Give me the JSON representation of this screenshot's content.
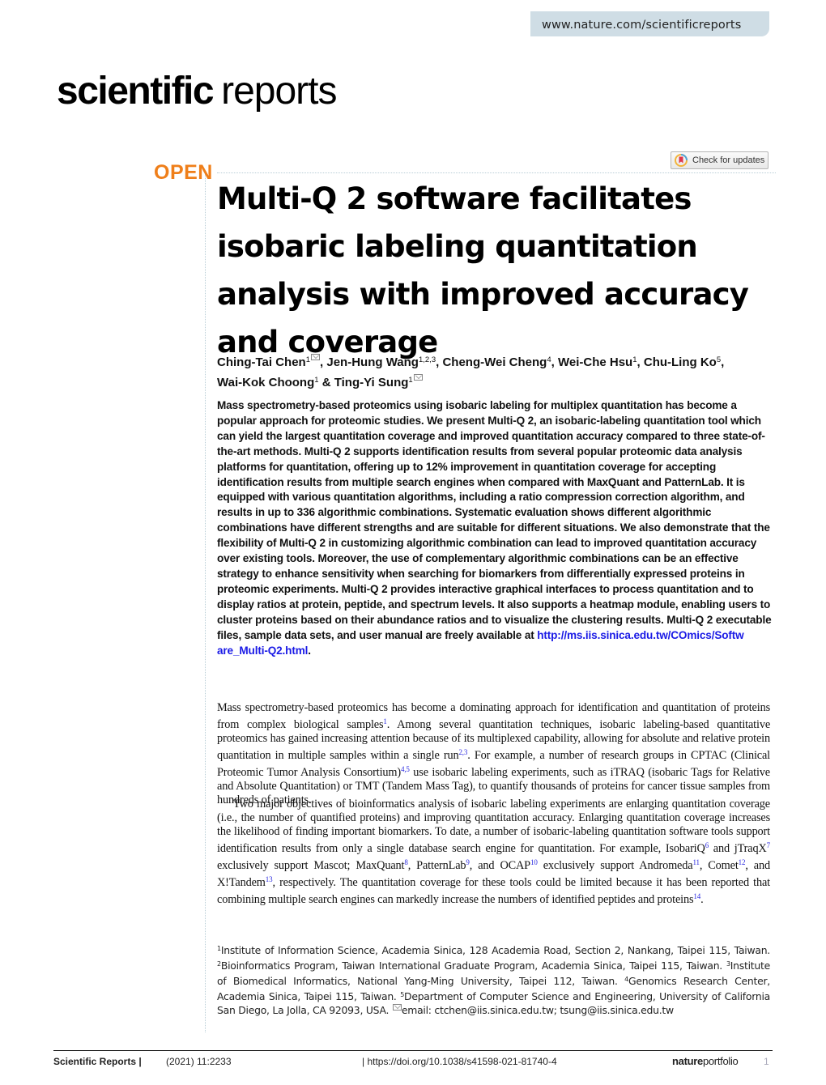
{
  "header": {
    "url": "www.nature.com/scientificreports",
    "journal_name_bold": "scientific",
    "journal_name_light": "reports",
    "check_updates_label": "Check for updates",
    "access_badge": "OPEN"
  },
  "article": {
    "title": "Multi-Q 2 software facilitates isobaric labeling quantitation analysis with improved accuracy and coverage",
    "authors": [
      {
        "name": "Ching-Tai Chen",
        "affil": "1",
        "corresponding": true,
        "sep": ", "
      },
      {
        "name": "Jen-Hung Wang",
        "affil": "1,2,3",
        "corresponding": false,
        "sep": ", "
      },
      {
        "name": "Cheng-Wei Cheng",
        "affil": "4",
        "corresponding": false,
        "sep": ", "
      },
      {
        "name": "Wei-Che Hsu",
        "affil": "1",
        "corresponding": false,
        "sep": ", "
      },
      {
        "name": "Chu-Ling Ko",
        "affil": "5",
        "corresponding": false,
        "sep": ", "
      },
      {
        "name": "Wai-Kok Choong",
        "affil": "1",
        "corresponding": false,
        "sep": " & "
      },
      {
        "name": "Ting-Yi Sung",
        "affil": "1",
        "corresponding": true,
        "sep": ""
      }
    ],
    "abstract": "Mass spectrometry-based proteomics using isobaric labeling for multiplex quantitation has become a popular approach for proteomic studies. We present Multi-Q 2, an isobaric-labeling quantitation tool which can yield the largest quantitation coverage and improved quantitation accuracy compared to three state-of-the-art methods. Multi-Q 2 supports identification results from several popular proteomic data analysis platforms for quantitation, offering up to 12% improvement in quantitation coverage for accepting identification results from multiple search engines when compared with MaxQuant and PatternLab. It is equipped with various quantitation algorithms, including a ratio compression correction algorithm, and results in up to 336 algorithmic combinations. Systematic evaluation shows different algorithmic combinations have different strengths and are suitable for different situations. We also demonstrate that the flexibility of Multi-Q 2 in customizing algorithmic combination can lead to improved quantitation accuracy over existing tools. Moreover, the use of complementary algorithmic combinations can be an effective strategy to enhance sensitivity when searching for biomarkers from differentially expressed proteins in proteomic experiments. Multi-Q 2 provides interactive graphical interfaces to process quantitation and to display ratios at protein, peptide, and spectrum levels. It also supports a heatmap module, enabling users to cluster proteins based on their abundance ratios and to visualize the clustering results. Multi-Q 2 executable files, sample data sets, and user manual are freely available at ",
    "abstract_link": "http://ms.iis.sinica.edu.tw/COmics/Software_Multi-Q2.html",
    "abstract_end": ".",
    "paragraphs": [
      [
        {
          "t": "Mass spectrometry-based proteomics has become a dominating approach for identification and quantitation of proteins from complex biological samples"
        },
        {
          "c": "1"
        },
        {
          "t": ". Among several quantitation techniques, isobaric labeling-based quantitative proteomics has gained increasing attention because of its multiplexed capability, allowing for absolute and relative protein quantitation in multiple samples within a single run"
        },
        {
          "c": "2,3"
        },
        {
          "t": ". For example, a number of research groups in CPTAC (Clinical Proteomic Tumor Analysis Consortium)"
        },
        {
          "c": "4,5"
        },
        {
          "t": " use isobaric labeling experiments, such as iTRAQ (isobaric Tags for Relative and Absolute Quantitation) or TMT (Tandem Mass Tag), to quantify thousands of proteins for cancer tissue samples from hundreds of patients."
        }
      ],
      [
        {
          "t": "Two major objectives of bioinformatics analysis of isobaric labeling experiments are enlarging quantitation coverage (i.e., the number of quantified proteins) and improving quantitation accuracy. Enlarging quantitation coverage increases the likelihood of finding important biomarkers. To date, a number of isobaric-labeling quantitation software tools support identification results from only a single database search engine for quantitation. For example, IsobariQ"
        },
        {
          "c": "6"
        },
        {
          "t": " and jTraqX"
        },
        {
          "c": "7"
        },
        {
          "t": " exclusively support Mascot; MaxQuant"
        },
        {
          "c": "8"
        },
        {
          "t": ", PatternLab"
        },
        {
          "c": "9"
        },
        {
          "t": ", and OCAP"
        },
        {
          "c": "10"
        },
        {
          "t": " exclusively support Andromeda"
        },
        {
          "c": "11"
        },
        {
          "t": ", Comet"
        },
        {
          "c": "12"
        },
        {
          "t": ", and X!Tandem"
        },
        {
          "c": "13"
        },
        {
          "t": ", respectively. The quantitation coverage for these tools could be limited because it has been reported that combining multiple search engines can markedly increase the numbers of identified peptides and proteins"
        },
        {
          "c": "14"
        },
        {
          "t": "."
        }
      ]
    ],
    "affiliations": [
      {
        "n": "1",
        "t": "Institute of Information Science, Academia Sinica, 128 Academia Road, Section 2, Nankang, Taipei 115, Taiwan. "
      },
      {
        "n": "2",
        "t": "Bioinformatics Program, Taiwan International Graduate Program, Academia Sinica, Taipei 115, Taiwan. "
      },
      {
        "n": "3",
        "t": "Institute of Biomedical Informatics, National Yang-Ming University, Taipei 112, Taiwan. "
      },
      {
        "n": "4",
        "t": "Genomics Research Center, Academia Sinica, Taipei 115, Taiwan. "
      },
      {
        "n": "5",
        "t": "Department of Computer Science and Engineering, University of California San Diego, La Jolla, CA 92093, USA. "
      }
    ],
    "email_line": "email: ctchen@iis.sinica.edu.tw; tsung@iis.sinica.edu.tw"
  },
  "footer": {
    "journal": "Scientific Reports |",
    "volume": "(2021) 11:2233",
    "doi": "| https://doi.org/10.1038/s41598-021-81740-4",
    "brand_bold": "nature",
    "brand_light": "portfolio",
    "page": "1"
  },
  "colors": {
    "open_accent": "#ef7f1a",
    "link": "#1a1ae6",
    "url_tab_bg": "#cfdde5"
  }
}
